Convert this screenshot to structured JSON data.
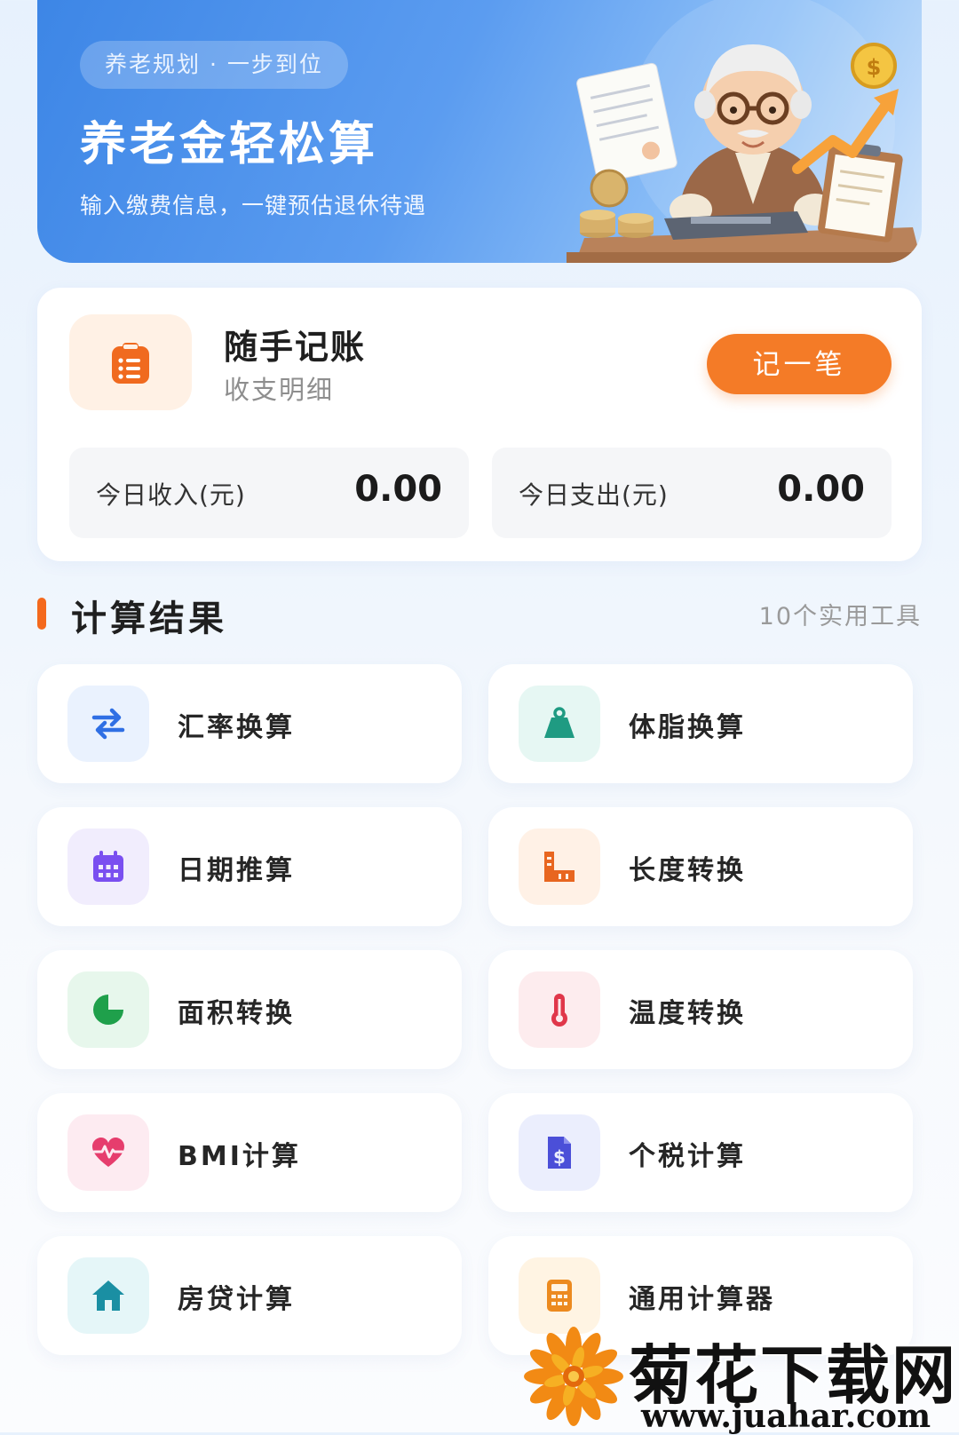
{
  "banner": {
    "tag": "养老规划 · 一步到位",
    "title": "养老金轻松算",
    "subtitle": "输入缴费信息，一键预估退休待遇"
  },
  "ledger": {
    "title": "随手记账",
    "subtitle": "收支明细",
    "button_label": "记一笔",
    "income_label": "今日收入(元)",
    "income_value": "0.00",
    "expense_label": "今日支出(元)",
    "expense_value": "0.00"
  },
  "section": {
    "title": "计算结果",
    "count_text": "10个实用工具"
  },
  "tools": [
    {
      "label": "汇率换算",
      "icon": "exchange-arrows-icon",
      "bg": "#eaf2fe",
      "color": "#2f6fe4"
    },
    {
      "label": "体脂换算",
      "icon": "weight-icon",
      "bg": "#e6f7f3",
      "color": "#1f9b82"
    },
    {
      "label": "日期推算",
      "icon": "calendar-icon",
      "bg": "#f1edfd",
      "color": "#7a4ff0"
    },
    {
      "label": "长度转换",
      "icon": "ruler-icon",
      "bg": "#fff1e6",
      "color": "#e86620"
    },
    {
      "label": "面积转换",
      "icon": "pie-chart-icon",
      "bg": "#e7f7ec",
      "color": "#1fa04b"
    },
    {
      "label": "温度转换",
      "icon": "thermometer-icon",
      "bg": "#fdecee",
      "color": "#e0374a"
    },
    {
      "label": "BMI计算",
      "icon": "heart-pulse-icon",
      "bg": "#fdebf1",
      "color": "#e63d6d"
    },
    {
      "label": "个税计算",
      "icon": "tax-document-icon",
      "bg": "#ebeefd",
      "color": "#4b4fd8"
    },
    {
      "label": "房贷计算",
      "icon": "house-icon",
      "bg": "#e5f6f8",
      "color": "#1a8fa3"
    },
    {
      "label": "通用计算器",
      "icon": "calculator-icon",
      "bg": "#fff4e3",
      "color": "#ec8a1f"
    }
  ],
  "watermark": {
    "text": "菊花下载网",
    "url": "www.juahar.com"
  },
  "colors": {
    "accent_orange": "#f47b27",
    "banner_blue": "#3d86e6",
    "section_bar": "#f4691d"
  }
}
